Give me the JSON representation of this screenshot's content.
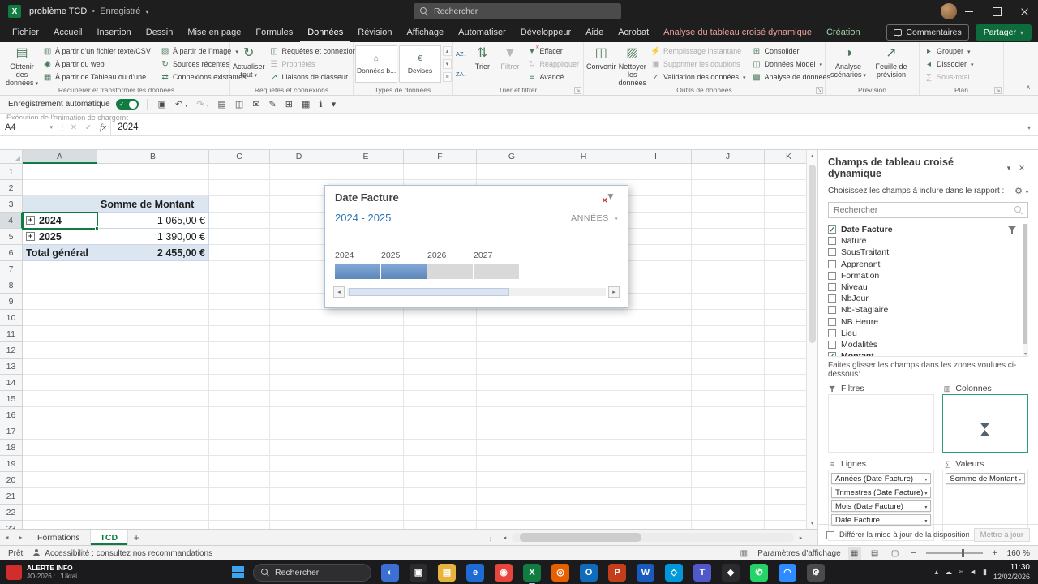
{
  "background_text": "Exécution de l'animation de chargement",
  "colors": {
    "accent_green": "#107c41",
    "pivot_fill": "#dce6f1",
    "timeline_selected": "#6f9bd1",
    "contextual_tab_red": "#e8a0a0",
    "contextual_tab_green": "#9fd3a8"
  },
  "titlebar": {
    "doc_title": "problème TCD",
    "doc_status": "Enregistré",
    "search_placeholder": "Rechercher"
  },
  "ribbon": {
    "comments_label": "Commentaires",
    "share_label": "Partager",
    "tabs": [
      {
        "label": "Fichier"
      },
      {
        "label": "Accueil"
      },
      {
        "label": "Insertion"
      },
      {
        "label": "Dessin"
      },
      {
        "label": "Mise en page"
      },
      {
        "label": "Formules"
      },
      {
        "label": "Données",
        "active": true
      },
      {
        "label": "Révision"
      },
      {
        "label": "Affichage"
      },
      {
        "label": "Automatiser"
      },
      {
        "label": "Développeur"
      },
      {
        "label": "Aide"
      },
      {
        "label": "Acrobat"
      },
      {
        "label": "Analyse du tableau croisé dynamique",
        "contextual": "red"
      },
      {
        "label": "Création",
        "contextual": "green"
      }
    ],
    "groups": [
      {
        "label": "Récupérer et transformer les données",
        "columns": [
          {
            "type": "big",
            "items": [
              {
                "label": "Obtenir des données",
                "icon": "database",
                "dd": true
              }
            ]
          },
          {
            "type": "stack",
            "items": [
              {
                "label": "À partir d'un fichier texte/CSV",
                "icon": "file-csv"
              },
              {
                "label": "À partir du web",
                "icon": "globe"
              },
              {
                "label": "À partir de Tableau ou d'une Plage",
                "icon": "table-range"
              }
            ]
          },
          {
            "type": "stack",
            "items": [
              {
                "label": "À partir de l'image",
                "icon": "image",
                "dd": true
              },
              {
                "label": "Sources récentes",
                "icon": "recent-sources"
              },
              {
                "label": "Connexions existantes",
                "icon": "connections"
              }
            ]
          }
        ]
      },
      {
        "label": "Requêtes et connexions",
        "columns": [
          {
            "type": "big",
            "items": [
              {
                "label": "Actualiser tout",
                "icon": "refresh",
                "dd": true
              }
            ]
          },
          {
            "type": "stack",
            "items": [
              {
                "label": "Requêtes et connexions",
                "icon": "queries-pane"
              },
              {
                "label": "Propriétés",
                "icon": "properties",
                "disabled": true
              },
              {
                "label": "Liaisons de classeur",
                "icon": "workbook-links"
              }
            ]
          }
        ]
      },
      {
        "label": "Types de données",
        "columns": [
          {
            "type": "tiles",
            "items": [
              {
                "label": "Données b...",
                "icon": "bank"
              },
              {
                "label": "Devises",
                "icon": "currency"
              }
            ]
          }
        ]
      },
      {
        "label": "Trier et filtrer",
        "launcher": true,
        "columns": [
          {
            "type": "sortpair",
            "items": [
              {
                "name": "sort-ascending",
                "glyph": "AZ↓"
              },
              {
                "name": "sort-descending",
                "glyph": "ZA↓"
              }
            ]
          },
          {
            "type": "big",
            "items": [
              {
                "label": "Trier",
                "icon": "sort-dialog"
              }
            ]
          },
          {
            "type": "big",
            "items": [
              {
                "label": "Filtrer",
                "icon": "filter-funnel",
                "disabled": true
              }
            ]
          },
          {
            "type": "stack",
            "items": [
              {
                "label": "Effacer",
                "icon": "clear-filter"
              },
              {
                "label": "Réappliquer",
                "icon": "reapply",
                "disabled": true
              },
              {
                "label": "Avancé",
                "icon": "advanced-filter"
              }
            ]
          }
        ]
      },
      {
        "label": "Outils de données",
        "launcher": true,
        "columns": [
          {
            "type": "big",
            "items": [
              {
                "label": "Convertir",
                "icon": "text-to-columns"
              }
            ]
          },
          {
            "type": "big",
            "items": [
              {
                "label": "Nettoyer les données",
                "icon": "clean-data"
              }
            ]
          },
          {
            "type": "stack",
            "items": [
              {
                "label": "Remplissage instantané",
                "icon": "flash-fill",
                "disabled": true
              },
              {
                "label": "Supprimer les doublons",
                "icon": "remove-duplicates",
                "disabled": true
              },
              {
                "label": "Validation des données",
                "icon": "data-validation",
                "dd": true
              }
            ]
          },
          {
            "type": "stack",
            "items": [
              {
                "label": "Consolider",
                "icon": "consolidate"
              },
              {
                "label": "Données Model",
                "icon": "data-model",
                "dd": true
              },
              {
                "label": "Analyse de données",
                "icon": "data-analysis"
              }
            ]
          }
        ]
      },
      {
        "label": "Prévision",
        "columns": [
          {
            "type": "big",
            "items": [
              {
                "label": "Analyse scénarios",
                "icon": "what-if",
                "dd": true
              }
            ]
          },
          {
            "type": "big",
            "items": [
              {
                "label": "Feuille de prévision",
                "icon": "forecast-sheet"
              }
            ]
          }
        ]
      },
      {
        "label": "Plan",
        "launcher": true,
        "columns": [
          {
            "type": "stack",
            "items": [
              {
                "label": "Grouper",
                "icon": "group",
                "dd": true
              },
              {
                "label": "Dissocier",
                "icon": "ungroup",
                "dd": true
              },
              {
                "label": "Sous-total",
                "icon": "subtotal",
                "disabled": true
              }
            ]
          }
        ]
      }
    ]
  },
  "quick_access": {
    "autosave_label": "Enregistrement automatique",
    "icons": [
      {
        "name": "save",
        "glyph": "▣"
      },
      {
        "name": "undo",
        "glyph": "↶",
        "dd": true
      },
      {
        "name": "redo",
        "glyph": "↷",
        "dd": true,
        "disabled": true
      },
      {
        "name": "print",
        "glyph": "▤"
      },
      {
        "name": "copy",
        "glyph": "◫"
      },
      {
        "name": "mail",
        "glyph": "✉"
      },
      {
        "name": "format-painter",
        "glyph": "✎"
      },
      {
        "name": "insert-table",
        "glyph": "⊞"
      },
      {
        "name": "borders",
        "glyph": "▦"
      },
      {
        "name": "info",
        "glyph": "ℹ"
      },
      {
        "name": "customize-toolbar",
        "glyph": "▾"
      }
    ]
  },
  "formula_bar": {
    "name_box": "A4",
    "fx_label": "fx",
    "value": "2024"
  },
  "grid": {
    "columns": [
      "A",
      "B",
      "C",
      "D",
      "E",
      "F",
      "G",
      "H",
      "I",
      "J",
      "K"
    ],
    "visible_rows": 23,
    "selected_cell": "A4",
    "cells": {
      "A3": {
        "text": "",
        "style": "header"
      },
      "B3": {
        "text": "Somme de Montant",
        "style": "header"
      },
      "A4": {
        "text": "2024",
        "style": "rowlabel",
        "expand": true
      },
      "B4": {
        "text": "1 065,00 €",
        "style": "value"
      },
      "A5": {
        "text": "2025",
        "style": "rowlabel",
        "expand": true
      },
      "B5": {
        "text": "1 390,00 €",
        "style": "value"
      },
      "A6": {
        "text": "Total général",
        "style": "total"
      },
      "B6": {
        "text": "2 455,00 €",
        "style": "total-value"
      }
    }
  },
  "timeline": {
    "title": "Date Facture",
    "selection_label": "2024 - 2025",
    "level_label": "ANNÉES",
    "years": [
      {
        "label": "2024",
        "selected": true
      },
      {
        "label": "2025",
        "selected": true
      },
      {
        "label": "2026",
        "selected": false
      },
      {
        "label": "2027",
        "selected": false
      }
    ]
  },
  "fields_pane": {
    "title": "Champs de tableau croisé dynamique",
    "subtitle": "Choisissez les champs à inclure dans le rapport :",
    "search_placeholder": "Rechercher",
    "fields": [
      {
        "name": "Date Facture",
        "checked": true,
        "filtered": true
      },
      {
        "name": "Nature"
      },
      {
        "name": "SousTraitant"
      },
      {
        "name": "Apprenant"
      },
      {
        "name": "Formation"
      },
      {
        "name": "Niveau"
      },
      {
        "name": "NbJour"
      },
      {
        "name": "Nb-Stagiaire"
      },
      {
        "name": "NB Heure"
      },
      {
        "name": "Lieu"
      },
      {
        "name": "Modalités"
      },
      {
        "name": "Montant",
        "checked": true,
        "partial": true
      }
    ],
    "drag_hint": "Faites glisser les champs dans les zones voulues ci-dessous:",
    "zones": {
      "filters_label": "Filtres",
      "columns_label": "Colonnes",
      "rows_label": "Lignes",
      "values_label": "Valeurs",
      "rows_items": [
        "Années (Date Facture)",
        "Trimestres (Date Facture)",
        "Mois (Date Facture)",
        "Date Facture"
      ],
      "values_items": [
        "Somme de Montant"
      ]
    },
    "defer_label": "Différer la mise à jour de la disposition",
    "update_label": "Mettre à jour"
  },
  "sheet_tabs": {
    "tabs": [
      {
        "label": "Formations"
      },
      {
        "label": "TCD",
        "active": true
      }
    ],
    "add_label": "+"
  },
  "status_bar": {
    "mode": "Prêt",
    "accessibility": "Accessibilité : consultez nos recommandations",
    "display_settings": "Paramètres d'affichage",
    "zoom_level": "160 %"
  },
  "taskbar": {
    "widget": {
      "line1": "ALERTE INFO",
      "line2": "JO-2026 : L'Ukrai..."
    },
    "search_label": "Rechercher",
    "apps": [
      {
        "name": "copilot",
        "glyph": "◐",
        "bg": "#3b6fd4"
      },
      {
        "name": "task-view",
        "glyph": "▣",
        "bg": "#2b2b2e"
      },
      {
        "name": "file-explorer",
        "glyph": "▤",
        "bg": "#e8b33c"
      },
      {
        "name": "edge",
        "glyph": "e",
        "bg": "#1e6bd6"
      },
      {
        "name": "chrome",
        "glyph": "◉",
        "bg": "#e8453c"
      },
      {
        "name": "excel",
        "glyph": "X",
        "bg": "#107c41",
        "active": true
      },
      {
        "name": "firefox",
        "glyph": "◎",
        "bg": "#e66000"
      },
      {
        "name": "outlook",
        "glyph": "O",
        "bg": "#0f6cbd"
      },
      {
        "name": "powerpoint",
        "glyph": "P",
        "bg": "#c43e1c"
      },
      {
        "name": "word",
        "glyph": "W",
        "bg": "#185abd"
      },
      {
        "name": "vscode",
        "glyph": "◇",
        "bg": "#0098db"
      },
      {
        "name": "teams",
        "glyph": "T",
        "bg": "#5059c9"
      },
      {
        "name": "store",
        "glyph": "◆",
        "bg": "#2b2b2e"
      },
      {
        "name": "whatsapp",
        "glyph": "✆",
        "bg": "#25d366"
      },
      {
        "name": "zoom",
        "glyph": "◠",
        "bg": "#2d8cff"
      },
      {
        "name": "settings",
        "glyph": "⚙",
        "bg": "#4a4a4a"
      }
    ],
    "tray": [
      {
        "name": "hidden-icons-chevron",
        "glyph": "▴"
      },
      {
        "name": "onedrive",
        "glyph": "☁"
      },
      {
        "name": "network",
        "glyph": "≈"
      },
      {
        "name": "volume",
        "glyph": "◄"
      },
      {
        "name": "battery",
        "glyph": "▮"
      }
    ],
    "time": "11:30",
    "date": "12/02/2026"
  }
}
